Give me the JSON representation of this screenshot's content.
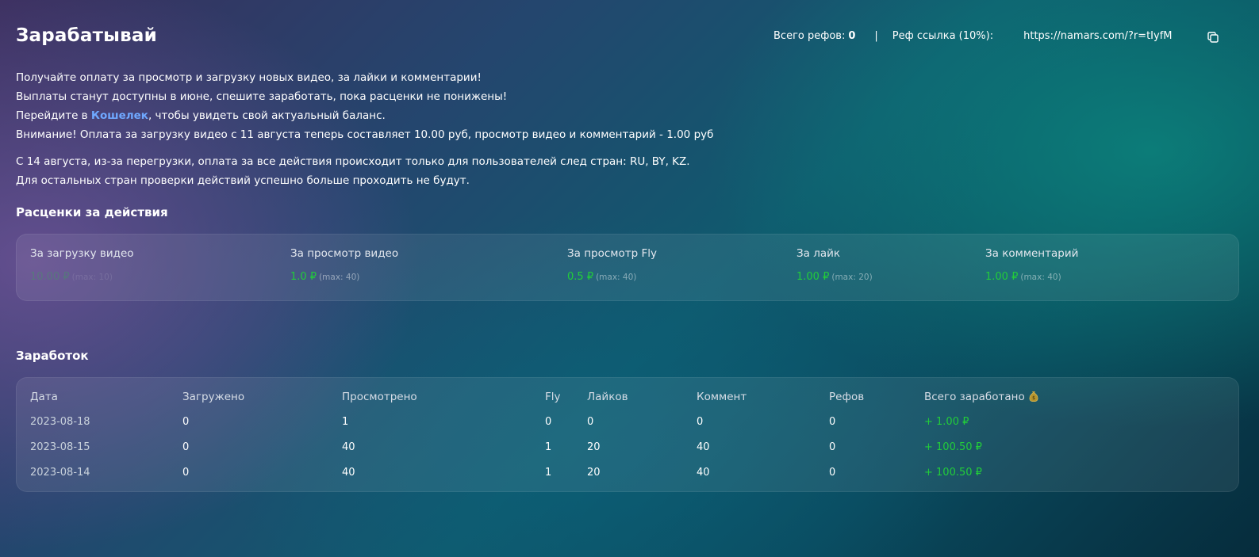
{
  "page_title": "Зарабатывай",
  "ref_bar": {
    "total_refs_label": "Всего рефов:",
    "total_refs_value": "0",
    "separator": "|",
    "ref_link_label": "Реф ссылка (10%):",
    "ref_link_value": "https://namars.com/?r=tIyfM"
  },
  "intro": {
    "line1": "Получайте оплату за просмотр и загрузку новых видео, за лайки и комментарии!",
    "line2": "Выплаты станут доступны в июне, спешите заработать, пока расценки не понижены!",
    "line3_prefix": "Перейдите в ",
    "line3_link": "Кошелек",
    "line3_suffix": ", чтобы увидеть свой актуальный баланс.",
    "line4": "Внимание! Оплата за загрузку видео с 11 августа теперь составляет 10.00 руб, просмотр видео и комментарий - 1.00 руб",
    "line5": "С 14 августа, из-за перегрузки, оплата за все действия происходит только для пользователей след стран: RU, BY, KZ.",
    "line6": "Для остальных стран проверки действий успешно больше проходить не будут."
  },
  "rates": {
    "title": "Расценки за действия",
    "items": [
      {
        "label": "За загрузку видео",
        "value": "10.00 ₽",
        "max": "(max: 10)"
      },
      {
        "label": "За просмотр видео",
        "value": "1.0 ₽",
        "max": "(max: 40)"
      },
      {
        "label": "За просмотр Fly",
        "value": "0.5 ₽",
        "max": "(max: 40)"
      },
      {
        "label": "За лайк",
        "value": "1.00 ₽",
        "max": "(max: 20)"
      },
      {
        "label": "За комментарий",
        "value": "1.00 ₽",
        "max": "(max: 40)"
      }
    ]
  },
  "earnings": {
    "title": "Заработок",
    "headers": [
      "Дата",
      "Загружено",
      "Просмотрено",
      "Fly",
      "Лайков",
      "Коммент",
      "Рефов",
      "Всего заработано"
    ],
    "rows": [
      [
        "2023-08-18",
        "0",
        "1",
        "0",
        "0",
        "0",
        "0",
        "+ 1.00 ₽"
      ],
      [
        "2023-08-15",
        "0",
        "40",
        "1",
        "20",
        "40",
        "0",
        "+ 100.50 ₽"
      ],
      [
        "2023-08-14",
        "0",
        "40",
        "1",
        "20",
        "40",
        "0",
        "+ 100.50 ₽"
      ]
    ]
  },
  "colors": {
    "accent_green": "#22cc3a",
    "link_blue": "#6fa8ff"
  }
}
